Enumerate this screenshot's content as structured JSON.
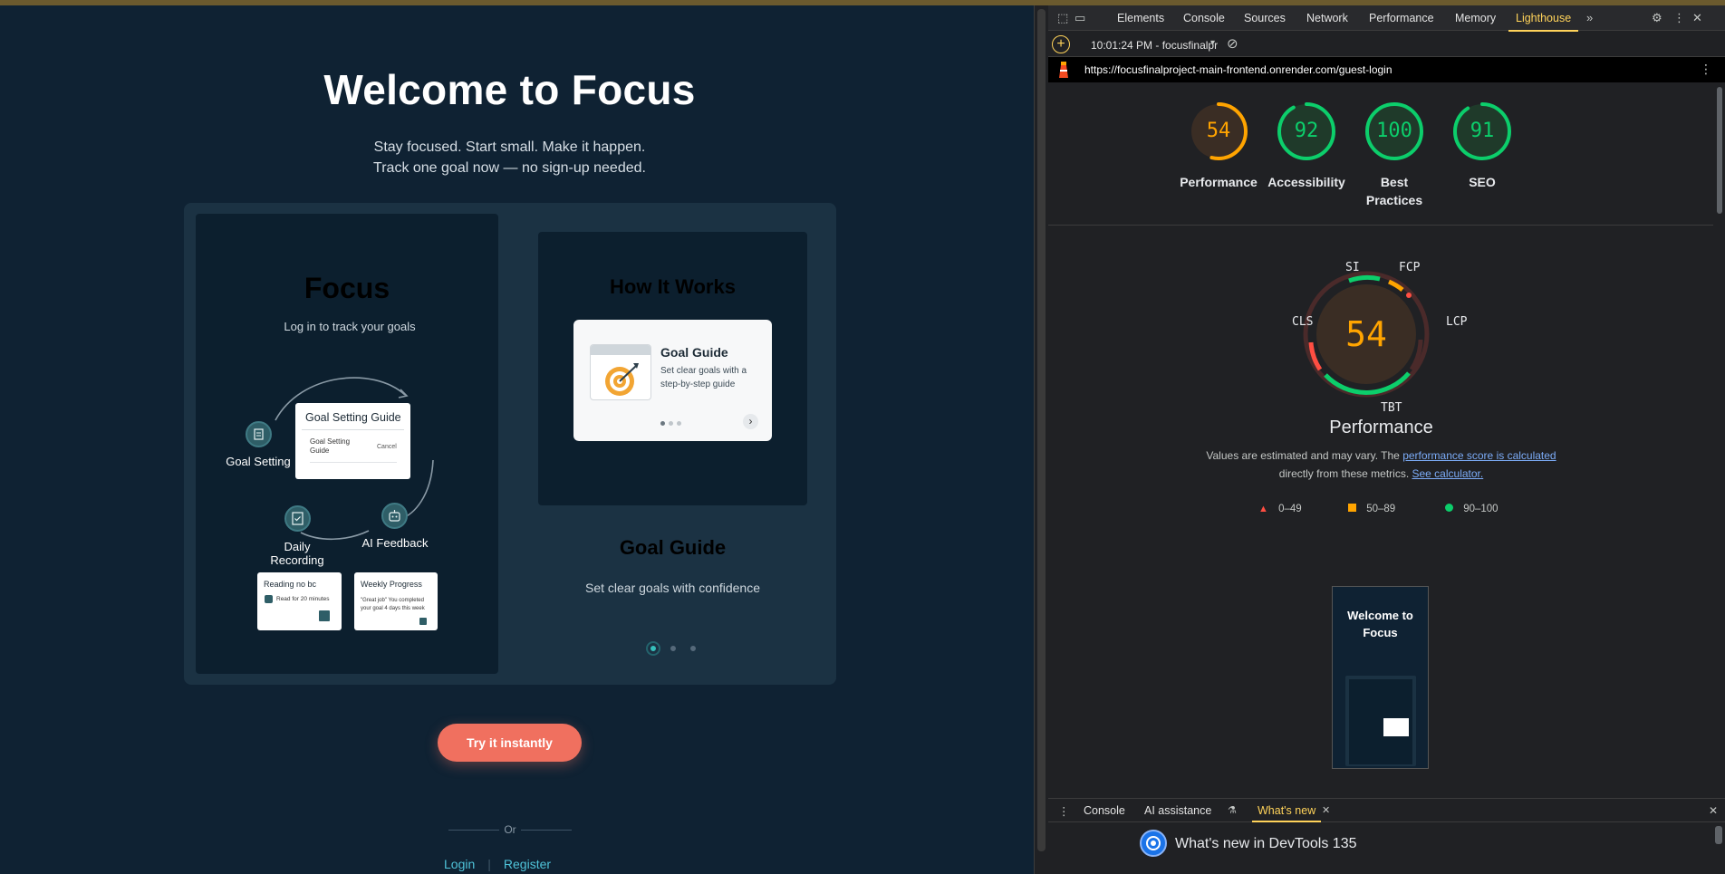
{
  "app": {
    "title": "Welcome to Focus",
    "subtitle_1": "Stay focused. Start small. Make it happen.",
    "subtitle_2": "Track one goal now — no sign-up needed.",
    "focus_card": {
      "title": "Focus",
      "subtitle": "Log in to track your goals",
      "nodes": {
        "goal_setting": "Goal Setting",
        "daily_recording": "Daily Recording",
        "ai_feedback": "AI Feedback"
      },
      "guide_card": {
        "title": "Goal Setting Guide",
        "item": "Goal Setting Guide",
        "cancel": "Cancel"
      },
      "reading_card": {
        "title": "Reading no bc",
        "check": "Read for 20 minutes"
      },
      "progress_card": {
        "title": "Weekly Progress",
        "quote": "\"Great job\" You completed your goal 4 days this week"
      }
    },
    "how_card": {
      "title": "How It Works",
      "guide_title": "Goal Guide",
      "guide_desc": "Set clear goals with a step-by-step guide"
    },
    "slide_title": "Goal Guide",
    "slide_desc": "Set clear goals with confidence",
    "try_button": "Try it instantly",
    "or_label": "Or",
    "login": "Login",
    "register": "Register",
    "colors": {
      "accent": "#f0705f",
      "teal": "#35c0bb",
      "bg": "#0f2233"
    }
  },
  "devtools": {
    "tabs": [
      "Elements",
      "Console",
      "Sources",
      "Network",
      "Performance",
      "Memory",
      "Lighthouse"
    ],
    "active_tab": "Lighthouse",
    "report_time": "10:01:24 PM - focusfinalpr",
    "url": "https://focusfinalproject-main-frontend.onrender.com/guest-login",
    "scores": [
      {
        "label": "Performance",
        "value": 54,
        "color": "#ffa400"
      },
      {
        "label": "Accessibility",
        "value": 92,
        "color": "#0cce6b"
      },
      {
        "label": "Best Practices",
        "value": 100,
        "color": "#0cce6b"
      },
      {
        "label": "SEO",
        "value": 91,
        "color": "#0cce6b"
      }
    ],
    "metrics": [
      "SI",
      "FCP",
      "LCP",
      "TBT",
      "CLS"
    ],
    "perf_score": "54",
    "perf_label": "Performance",
    "note_1": "Values are estimated and may vary. The",
    "note_link_1": "performance score is calculated",
    "note_2": "directly from these metrics.",
    "note_link_2": "See calculator.",
    "legend": [
      "0–49",
      "50–89",
      "90–100"
    ],
    "thumb_title": "Welcome to Focus",
    "drawer_tabs": [
      "Console",
      "AI assistance",
      "What's new"
    ],
    "drawer_active": "What's new",
    "whats_new": "What's new in DevTools 135"
  }
}
